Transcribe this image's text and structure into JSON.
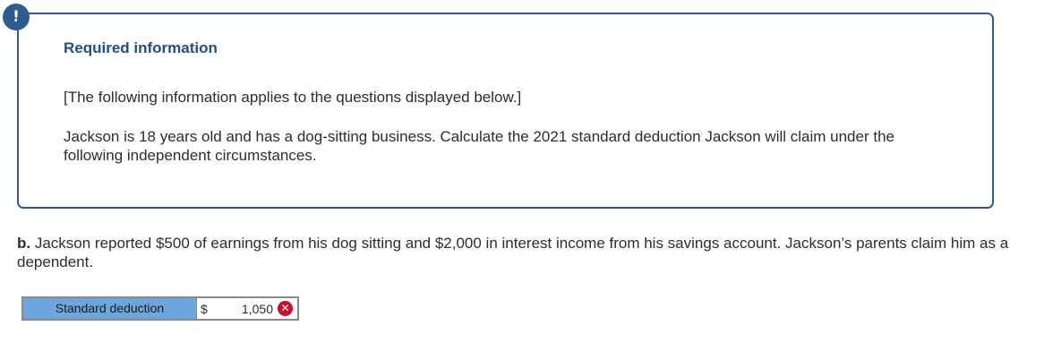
{
  "alert": {
    "icon": "exclamation-icon",
    "symbol": "!",
    "color": "#2b5d93"
  },
  "info": {
    "title": "Required information",
    "note": "[The following information applies to the questions displayed below.]",
    "body": "Jackson is 18 years old and has a dog-sitting business. Calculate the 2021 standard deduction Jackson will claim under the following independent circumstances."
  },
  "question": {
    "letter": "b.",
    "text": "Jackson reported $500 of earnings from his dog sitting and $2,000 in interest income from his savings account. Jackson’s parents claim him as a dependent."
  },
  "answer": {
    "label": "Standard deduction",
    "currency": "$",
    "value": "1,050",
    "status": "incorrect",
    "status_icon": "incorrect-x-icon",
    "status_symbol": "✕",
    "status_color": "#c8102e"
  }
}
